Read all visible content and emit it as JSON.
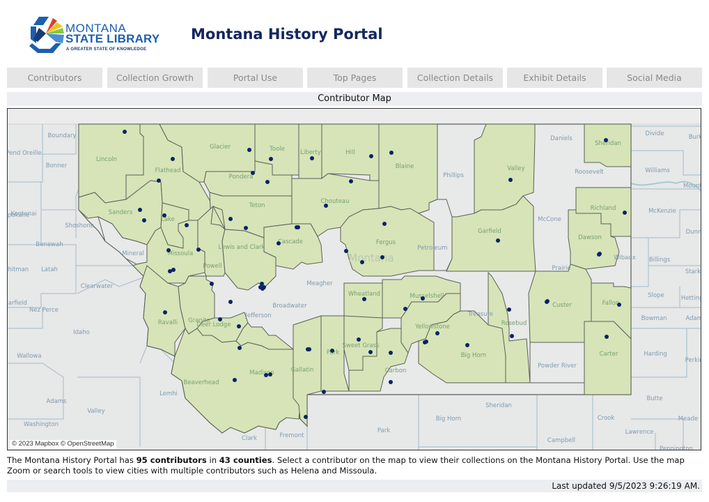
{
  "header": {
    "logo": {
      "line1": "MONTANA",
      "line2": "STATE LIBRARY",
      "tagline": "A GREATER STATE OF KNOWLEDGE",
      "colors": {
        "blue": "#1c5fb0",
        "navy": "#1a3b73",
        "red": "#e63a2e",
        "yellow": "#f2c318",
        "green": "#8cc63e",
        "lightblue": "#4a90d0"
      }
    },
    "title": "Montana History Portal"
  },
  "tabs": [
    {
      "label": "Contributors"
    },
    {
      "label": "Collection Growth"
    },
    {
      "label": "Portal Use"
    },
    {
      "label": "Top Pages"
    },
    {
      "label": "Collection Details"
    },
    {
      "label": "Exhibit Details"
    },
    {
      "label": "Social Media"
    }
  ],
  "section_title": "Contributor Map",
  "map": {
    "colors": {
      "covered": "#d6e4b8",
      "uncovered": "#e8e9e9",
      "border": "#5b5f57",
      "dot": "#0b2264",
      "water": "#bcd6d8"
    },
    "attribution": "© 2023 Mapbox © OpenStreetMap",
    "state_label": "Montana",
    "montana_county_labels": [
      "Lincoln",
      "Flathead",
      "Glacier",
      "Toole",
      "Liberty",
      "Hill",
      "Blaine",
      "Phillips",
      "Valley",
      "Daniels",
      "Sheridan",
      "Roosevelt",
      "Pondera",
      "Teton",
      "Chouteau",
      "Lake",
      "Sanders",
      "Mineral",
      "Missoula",
      "Powell",
      "Lewis and Clark",
      "Cascade",
      "Fergus",
      "Petroleum",
      "Garfield",
      "McCone",
      "Richland",
      "Dawson",
      "Wibaux",
      "Prairie",
      "Ravalli",
      "Granite",
      "Deer Lodge",
      "Jefferson",
      "Broadwater",
      "Meagher",
      "Wheatland",
      "Musselshell",
      "Treasure",
      "Rosebud",
      "Custer",
      "Fallon",
      "Beaverhead",
      "Madison",
      "Gallatin",
      "Park",
      "Sweet Grass",
      "Carbon",
      "Yellowstone",
      "Big Horn",
      "Powder River",
      "Carter"
    ],
    "neighbor_labels": [
      "Boundary",
      "Pend Oreille",
      "Bonner",
      "Kootenai",
      "Shoshone",
      "Spokane",
      "Benewah",
      "Latah",
      "Whitman",
      "Clearwater",
      "Nez Perce",
      "Garfield",
      "Idaho",
      "Wallowa",
      "Lemhi",
      "Adams",
      "Valley",
      "Washington",
      "Clark",
      "Fremont",
      "Park",
      "Big Horn",
      "Sheridan",
      "Crook",
      "Campbell",
      "Divide",
      "Burke",
      "Williams",
      "Mountrail",
      "McKenzie",
      "Dunn",
      "Billings",
      "Stark",
      "Slope",
      "Hettinger",
      "Bowman",
      "Adams",
      "Harding",
      "Perkins",
      "Butte",
      "Meade",
      "Lawrence",
      "Pennington"
    ],
    "contributor_count_dots": 95
  },
  "description": {
    "prefix": "The Montana History Portal has ",
    "contributors": "95 contributors",
    "middle": " in ",
    "counties": "43 counties",
    "suffix": ". Select a contributor on the map to view their collections on the Montana History Portal. Use the map Zoom or search tools to view cities with multiple contributors such as Helena and Missoula."
  },
  "footer": {
    "last_updated": "Last updated 9/5/2023 9:26:19 AM."
  }
}
